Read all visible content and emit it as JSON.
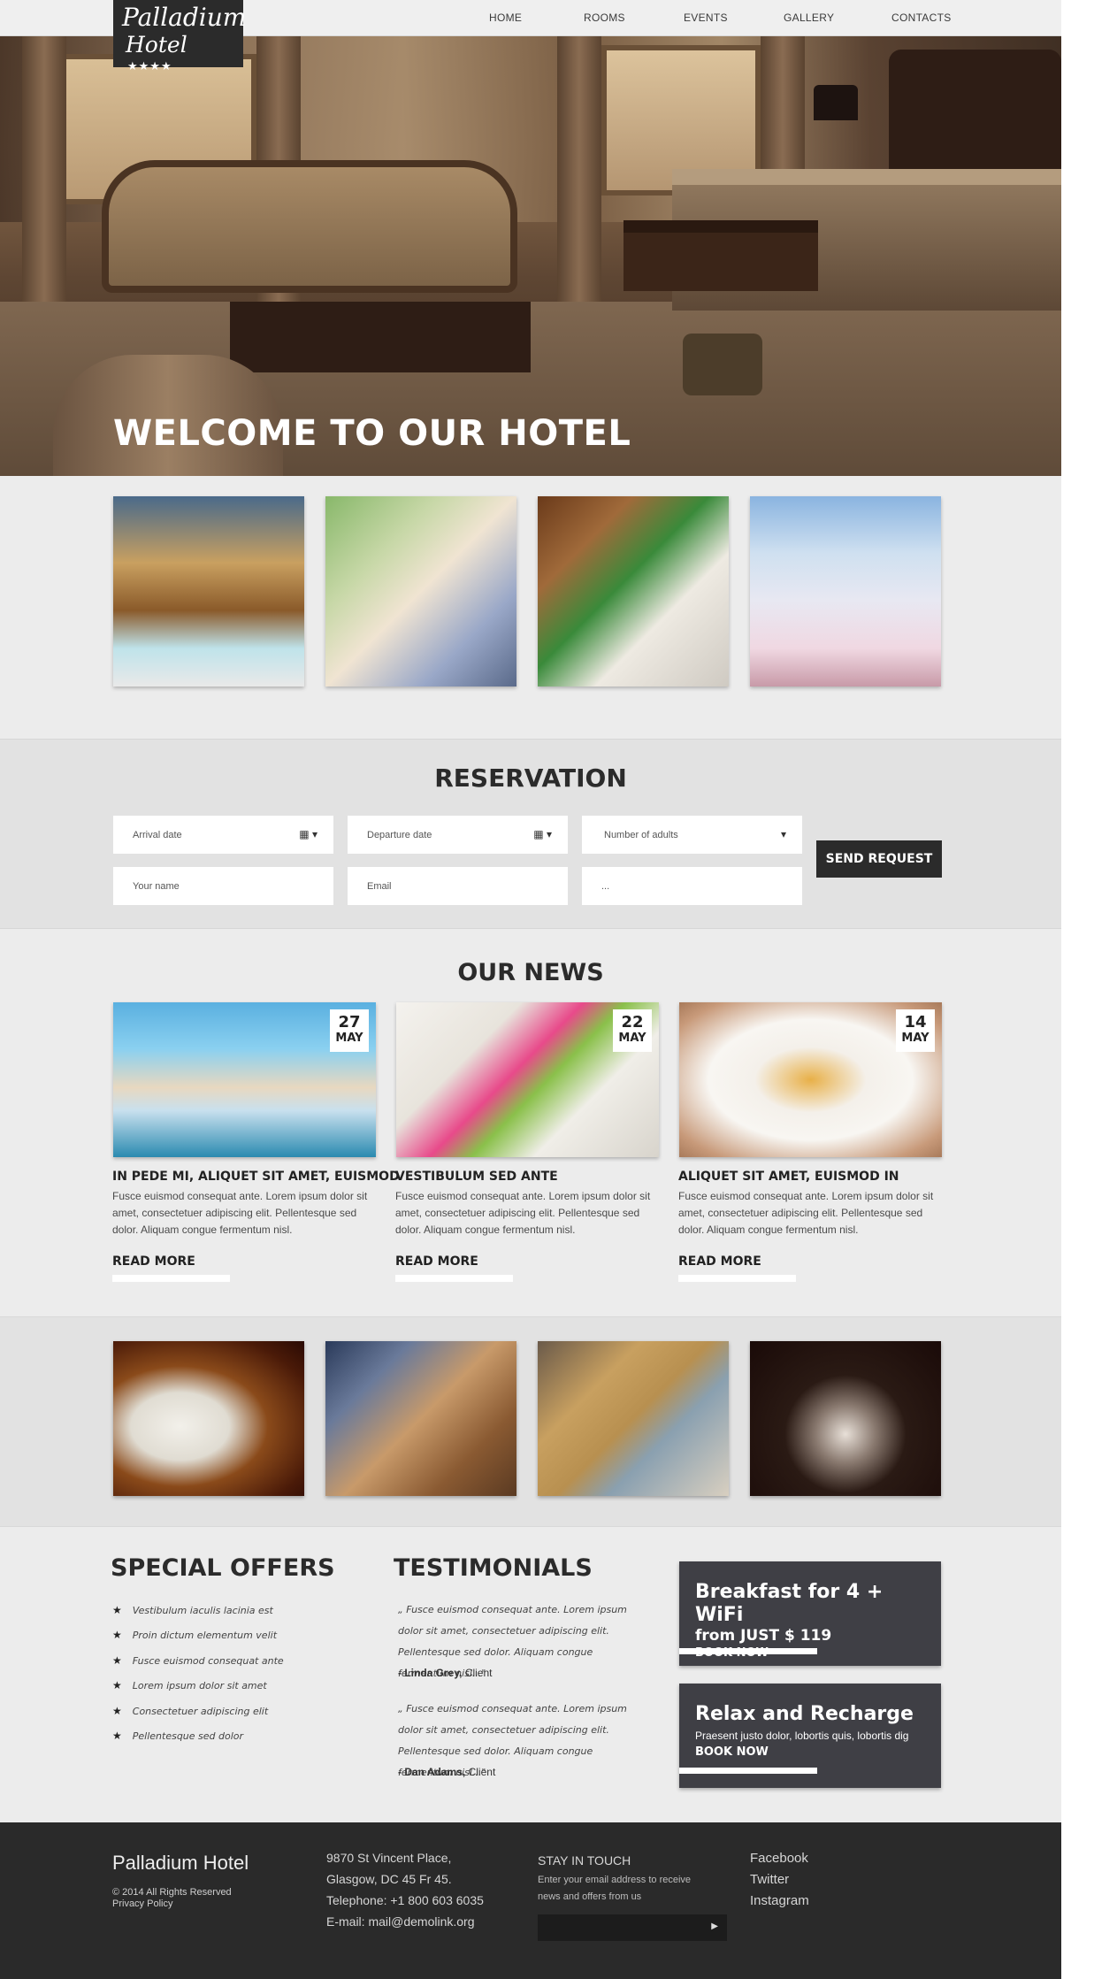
{
  "brand": {
    "logo_line1": "Palladium",
    "logo_line2": "Hotel",
    "logo_stars": "★★★★"
  },
  "nav": [
    "HOME",
    "ROOMS",
    "EVENTS",
    "GALLERY",
    "CONTACTS"
  ],
  "hero": {
    "title": "WELCOME TO OUR HOTEL"
  },
  "reservation": {
    "title": "RESERVATION",
    "arrival_placeholder": "Arrival date",
    "departure_placeholder": "Departure date",
    "adults_placeholder": "Number of adults",
    "name_placeholder": "Your name",
    "email_placeholder": "Email",
    "message_placeholder": "...",
    "send_label": "SEND REQUEST"
  },
  "news": {
    "title": "OUR NEWS",
    "items": [
      {
        "day": "27",
        "month": "MAY",
        "title": "IN PEDE MI, ALIQUET SIT AMET, EUISMOD",
        "text": "Fusce euismod consequat ante. Lorem ipsum dolor sit amet, consectetuer adipiscing elit. Pellentesque sed dolor. Aliquam congue fermentum nisl.",
        "more": "READ MORE"
      },
      {
        "day": "22",
        "month": "MAY",
        "title": "VESTIBULUM SED ANTE",
        "text": "Fusce euismod consequat ante. Lorem ipsum dolor sit amet, consectetuer adipiscing elit. Pellentesque sed dolor. Aliquam congue fermentum nisl.",
        "more": "READ MORE"
      },
      {
        "day": "14",
        "month": "MAY",
        "title": "ALIQUET SIT AMET, EUISMOD IN",
        "text": "Fusce euismod consequat ante. Lorem ipsum dolor sit amet, consectetuer adipiscing elit. Pellentesque sed dolor. Aliquam congue fermentum nisl.",
        "more": "READ MORE"
      }
    ]
  },
  "offers": {
    "title": "SPECIAL OFFERS",
    "items": [
      "Vestibulum iaculis lacinia est",
      "Proin dictum elementum velit",
      "Fusce euismod consequat ante",
      "Lorem ipsum dolor sit amet",
      "Consectetuer adipiscing elit",
      "Pellentesque sed dolor"
    ]
  },
  "testimonials": {
    "title": "TESTIMONIALS",
    "items": [
      {
        "quote": "„ Fusce euismod consequat ante. Lorem ipsum dolor sit amet, consectetuer adipiscing elit. Pellentesque sed dolor. Aliquam congue fermentum nisl...\"",
        "author": "- Linda Grey,",
        "role": "Client"
      },
      {
        "quote": "„ Fusce euismod consequat ante. Lorem ipsum dolor sit amet, consectetuer adipiscing elit. Pellentesque sed dolor. Aliquam congue fermentum nisl...\"",
        "author": "- Dan Adams,",
        "role": "Client"
      }
    ]
  },
  "promos": [
    {
      "title": "Breakfast for 4 + WiFi",
      "subtitle": "from JUST $ 119",
      "cta": "BOOK NOW"
    },
    {
      "title": "Relax and Recharge",
      "subtitle": "Praesent justo dolor, lobortis quis, lobortis dig",
      "cta": "BOOK NOW"
    }
  ],
  "footer": {
    "brand": "Palladium Hotel",
    "copyright": "© 2014 All Rights Reserved",
    "privacy": "Privacy Policy",
    "address1": "9870 St Vincent Place,",
    "address2": "Glasgow, DC 45 Fr 45.",
    "phone": "Telephone:  +1 800 603 6035",
    "email": "E-mail: mail@demolink.org",
    "touch_title": "STAY IN TOUCH",
    "touch_text": "Enter your email address to receive news and offers from us",
    "social": [
      "Facebook",
      "Twitter",
      "Instagram"
    ]
  },
  "colors": {
    "dark": "#2b2b2b",
    "promo": "#3f3f45",
    "background": "#ececec",
    "footer": "#2a2a2a"
  },
  "icons": {
    "calendar": "calendar-icon",
    "dropdown": "caret-down-icon",
    "star": "star-icon",
    "submit": "arrow-right-icon"
  }
}
